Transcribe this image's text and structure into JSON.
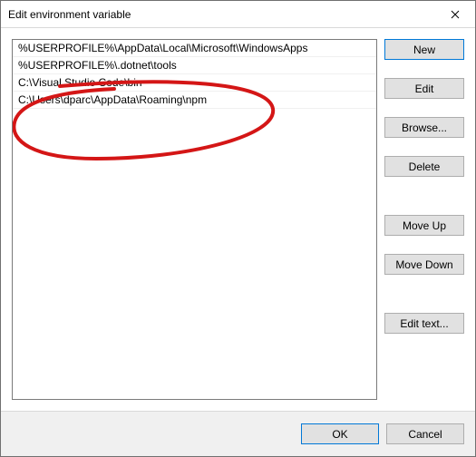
{
  "window": {
    "title": "Edit environment variable"
  },
  "list": {
    "items": [
      "%USERPROFILE%\\AppData\\Local\\Microsoft\\WindowsApps",
      "%USERPROFILE%\\.dotnet\\tools",
      "C:\\Visual Studio Code\\bin",
      "C:\\Users\\dparc\\AppData\\Roaming\\npm"
    ]
  },
  "buttons": {
    "new": "New",
    "edit": "Edit",
    "browse": "Browse...",
    "delete": "Delete",
    "moveup": "Move Up",
    "movedown": "Move Down",
    "edittext": "Edit text...",
    "ok": "OK",
    "cancel": "Cancel"
  }
}
